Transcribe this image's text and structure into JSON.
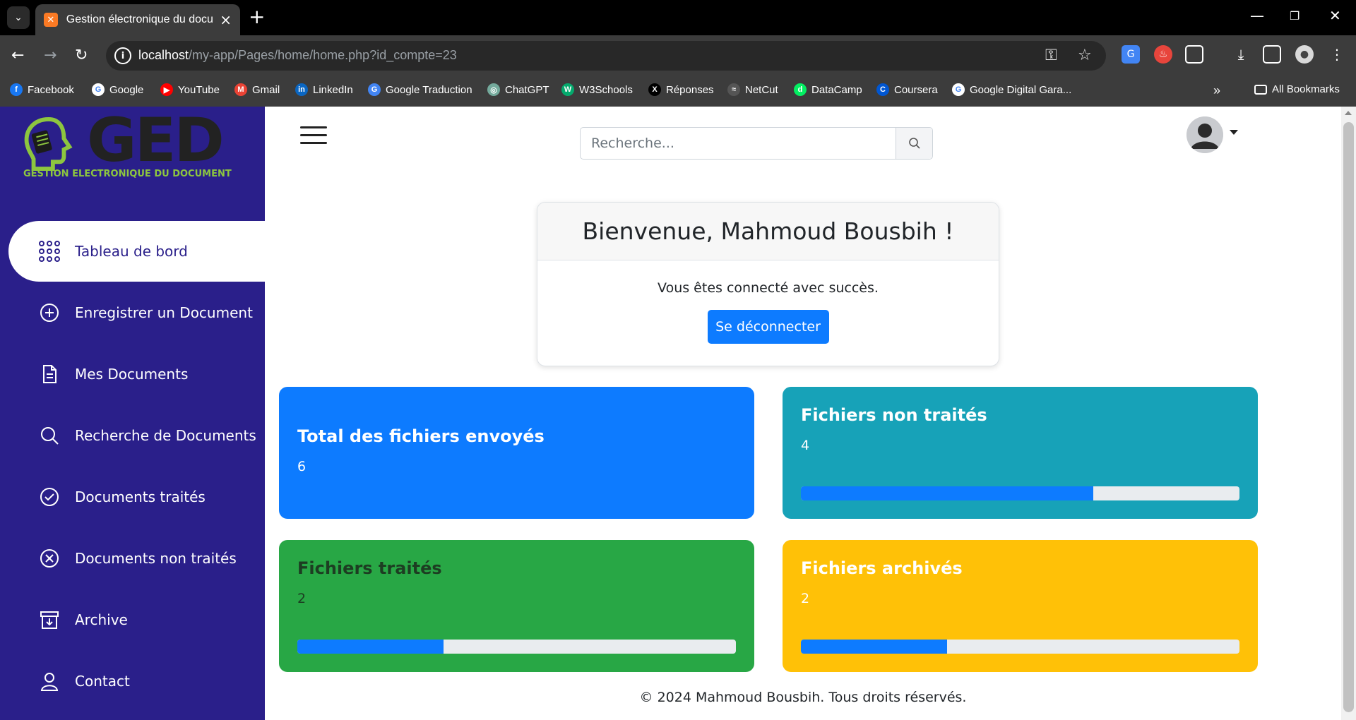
{
  "browser": {
    "tab_title": "Gestion électronique du docum",
    "url_host": "localhost",
    "url_path": "/my-app/Pages/home/home.php?id_compte=23",
    "bookmarks": [
      {
        "label": "Facebook",
        "icon": "facebook-icon",
        "color": "#1877f2"
      },
      {
        "label": "Google",
        "icon": "google-icon",
        "color": "#ffffff"
      },
      {
        "label": "YouTube",
        "icon": "youtube-icon",
        "color": "#ff0000"
      },
      {
        "label": "Gmail",
        "icon": "gmail-icon",
        "color": "#ea4335"
      },
      {
        "label": "LinkedIn",
        "icon": "linkedin-icon",
        "color": "#0a66c2"
      },
      {
        "label": "Google Traduction",
        "icon": "translate-icon",
        "color": "#4285f4"
      },
      {
        "label": "ChatGPT",
        "icon": "chatgpt-icon",
        "color": "#74aa9c"
      },
      {
        "label": "W3Schools",
        "icon": "w3schools-icon",
        "color": "#04aa6d"
      },
      {
        "label": "Réponses",
        "icon": "x-icon",
        "color": "#000000"
      },
      {
        "label": "NetCut",
        "icon": "netcut-icon",
        "color": "#555555"
      },
      {
        "label": "DataCamp",
        "icon": "datacamp-icon",
        "color": "#03ef62"
      },
      {
        "label": "Coursera",
        "icon": "coursera-icon",
        "color": "#0056d2"
      },
      {
        "label": "Google Digital Gara...",
        "icon": "google-icon",
        "color": "#ffffff"
      }
    ],
    "all_bookmarks": "All Bookmarks"
  },
  "logo": {
    "letters": "GED",
    "subtitle": "GESTION ELECTRONIQUE DU DOCUMENT"
  },
  "sidebar": {
    "items": [
      {
        "label": "Tableau de bord",
        "icon": "grid-icon",
        "active": true
      },
      {
        "label": "Enregistrer un Document",
        "icon": "plus-circle-icon"
      },
      {
        "label": "Mes Documents",
        "icon": "document-icon"
      },
      {
        "label": "Recherche de Documents",
        "icon": "search-icon"
      },
      {
        "label": "Documents traités",
        "icon": "check-circle-icon"
      },
      {
        "label": "Documents non traités",
        "icon": "x-circle-icon"
      },
      {
        "label": "Archive",
        "icon": "archive-icon"
      },
      {
        "label": "Contact",
        "icon": "user-icon"
      }
    ]
  },
  "header": {
    "search_placeholder": "Recherche..."
  },
  "welcome": {
    "title": "Bienvenue, Mahmoud Bousbih !",
    "message": "Vous êtes connecté avec succès.",
    "logout_label": "Se déconnecter"
  },
  "stats": {
    "total": {
      "title": "Total des fichiers envoyés",
      "value": "6",
      "color": "#0d7bff"
    },
    "non_traites": {
      "title": "Fichiers non traités",
      "value": "4",
      "color": "#17a2b8",
      "progress": 0.667
    },
    "traites": {
      "title": "Fichiers traités",
      "value": "2",
      "color": "#28a745",
      "progress": 0.333
    },
    "archives": {
      "title": "Fichiers archivés",
      "value": "2",
      "color": "#ffc107",
      "progress": 0.333
    }
  },
  "footer": {
    "text": "© 2024 Mahmoud Bousbih. Tous droits réservés."
  }
}
